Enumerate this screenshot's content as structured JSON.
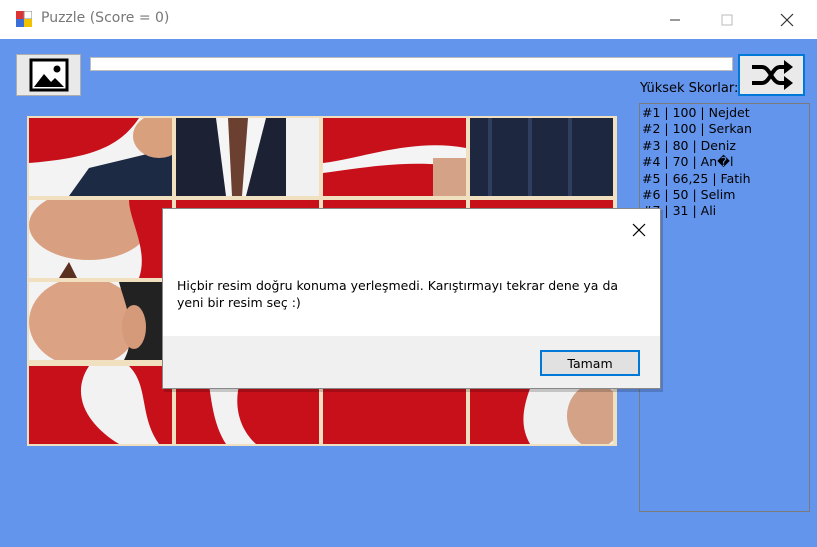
{
  "window": {
    "title": "Puzzle (Score = 0)"
  },
  "toolbar": {
    "progress_percent": 0
  },
  "scores": {
    "label": "Yüksek Skorlar:",
    "items": [
      "#1 | 100 | Nejdet",
      "#2 | 100 | Serkan",
      "#3 | 80 | Deniz",
      "#4 | 70 | An�l",
      "#5 | 66,25 | Fatih",
      "#6 | 50 | Selim",
      "#7 | 31 | Ali"
    ]
  },
  "dialog": {
    "message": "Hiçbir resim doğru konuma yerleşmedi. Karıştırmayı tekrar dene ya da yeni bir resim seç :)",
    "ok_label": "Tamam"
  },
  "colors": {
    "background": "#6495ed",
    "accent": "#0078d7",
    "flag_red": "#d0101a"
  }
}
